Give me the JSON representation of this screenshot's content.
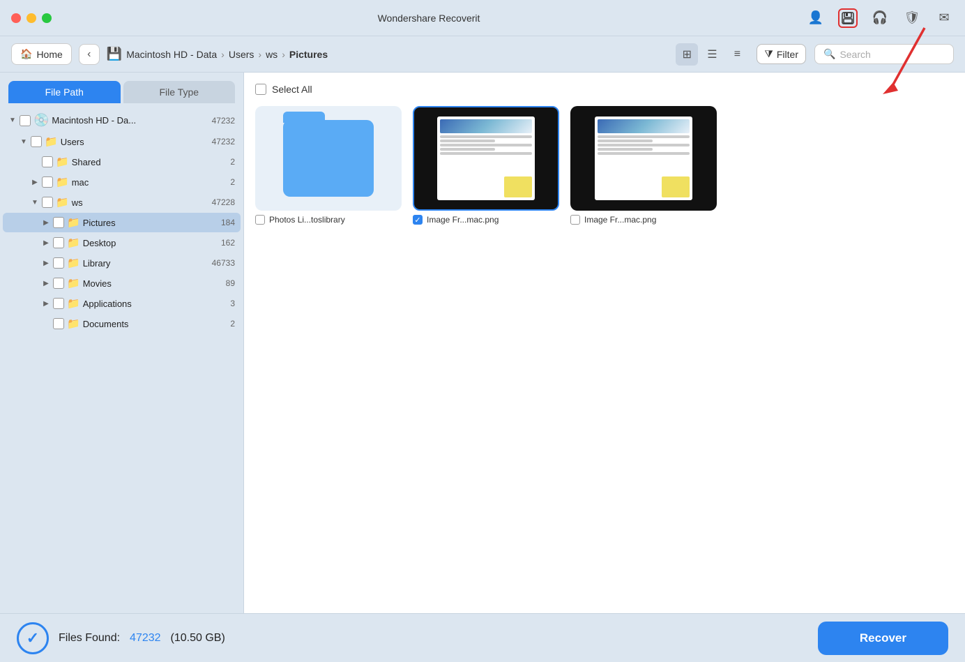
{
  "app": {
    "title": "Wondershare Recoverit"
  },
  "titlebar": {
    "icons": [
      "person-icon",
      "save-icon",
      "headphones-icon",
      "shield-icon",
      "mail-icon"
    ]
  },
  "breadcrumb": {
    "home_label": "Home",
    "path": [
      "Macintosh HD - Data",
      "Users",
      "ws",
      "Pictures"
    ],
    "path_display": "Macintosh HD - Data > Users > ws > Pictures"
  },
  "view": {
    "filter_label": "Filter",
    "search_placeholder": "Search"
  },
  "sidebar": {
    "tab_filepath": "File Path",
    "tab_filetype": "File Type",
    "tree": [
      {
        "id": "macintosh",
        "label": "Macintosh HD - Da...",
        "count": "47232",
        "indent": 0,
        "type": "hdd",
        "chevron": "▼"
      },
      {
        "id": "users",
        "label": "Users",
        "count": "47232",
        "indent": 1,
        "type": "folder",
        "chevron": "▼"
      },
      {
        "id": "shared",
        "label": "Shared",
        "count": "2",
        "indent": 2,
        "type": "folder",
        "chevron": ""
      },
      {
        "id": "mac",
        "label": "mac",
        "count": "2",
        "indent": 2,
        "type": "folder",
        "chevron": "▶"
      },
      {
        "id": "ws",
        "label": "ws",
        "count": "47228",
        "indent": 2,
        "type": "folder",
        "chevron": "▼"
      },
      {
        "id": "pictures",
        "label": "Pictures",
        "count": "184",
        "indent": 3,
        "type": "folder",
        "chevron": "▶",
        "selected": true
      },
      {
        "id": "desktop",
        "label": "Desktop",
        "count": "162",
        "indent": 3,
        "type": "folder",
        "chevron": "▶"
      },
      {
        "id": "library",
        "label": "Library",
        "count": "46733",
        "indent": 3,
        "type": "folder",
        "chevron": "▶"
      },
      {
        "id": "movies",
        "label": "Movies",
        "count": "89",
        "indent": 3,
        "type": "folder",
        "chevron": "▶"
      },
      {
        "id": "applications",
        "label": "Applications",
        "count": "3",
        "indent": 3,
        "type": "folder",
        "chevron": "▶"
      },
      {
        "id": "documents",
        "label": "Documents",
        "count": "2",
        "indent": 3,
        "type": "folder",
        "chevron": ""
      }
    ]
  },
  "content": {
    "select_all_label": "Select All",
    "files": [
      {
        "id": "file1",
        "name": "Photos Li...toslibrary",
        "type": "folder",
        "selected": false
      },
      {
        "id": "file2",
        "name": "Image Fr...mac.png",
        "type": "document",
        "selected": true
      },
      {
        "id": "file3",
        "name": "Image Fr...mac.png",
        "type": "document",
        "selected": false
      }
    ]
  },
  "bottom": {
    "files_found_label": "Files Found:",
    "count": "47232",
    "size": "(10.50 GB)",
    "recover_label": "Recover"
  }
}
